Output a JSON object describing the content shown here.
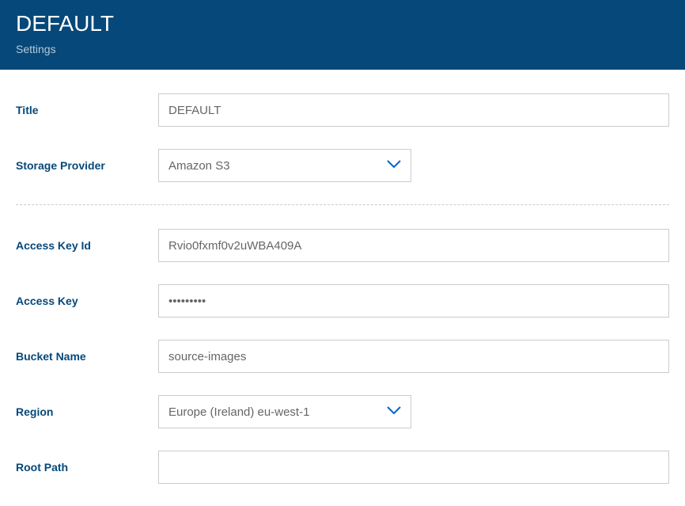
{
  "header": {
    "title": "DEFAULT",
    "subtitle": "Settings"
  },
  "form": {
    "title": {
      "label": "Title",
      "value": "DEFAULT"
    },
    "storage_provider": {
      "label": "Storage Provider",
      "value": "Amazon S3"
    },
    "access_key_id": {
      "label": "Access Key Id",
      "value": "Rvio0fxmf0v2uWBA409A"
    },
    "access_key": {
      "label": "Access Key",
      "value": "•••••••••"
    },
    "bucket_name": {
      "label": "Bucket Name",
      "value": "source-images"
    },
    "region": {
      "label": "Region",
      "value": "Europe (Ireland) eu-west-1"
    },
    "root_path": {
      "label": "Root Path",
      "value": ""
    }
  }
}
